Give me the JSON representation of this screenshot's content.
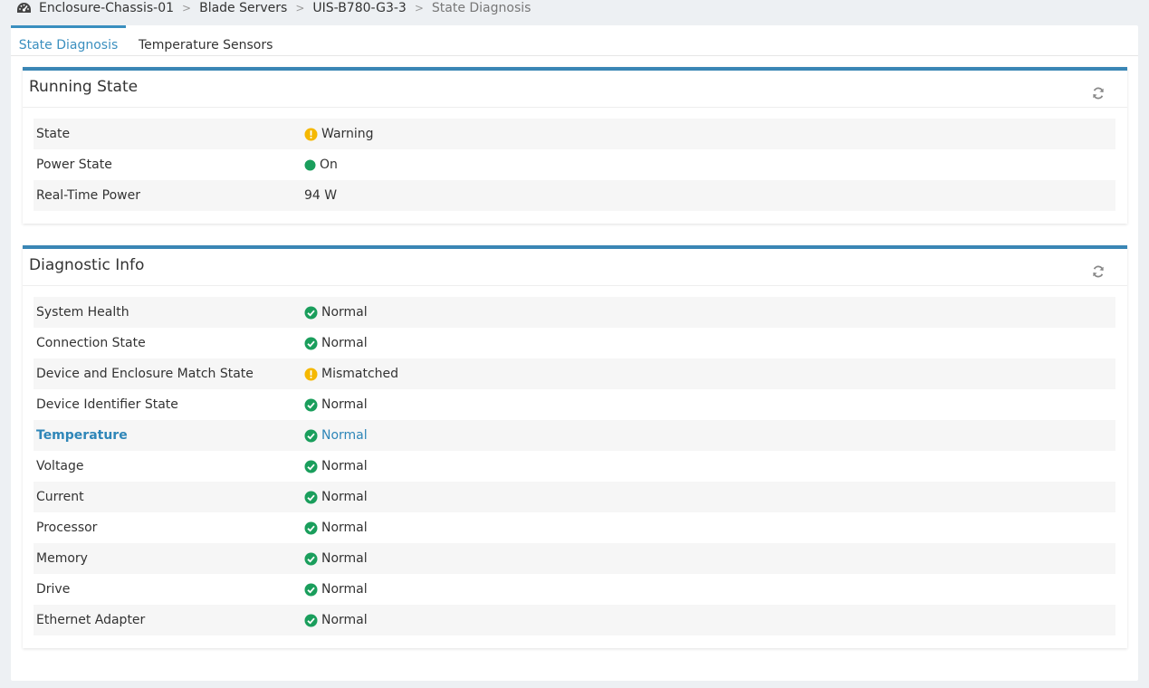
{
  "breadcrumb": {
    "items": [
      "Enclosure-Chassis-01",
      "Blade Servers",
      "UIS-B780-G3-3",
      "State Diagnosis"
    ],
    "separator": ">"
  },
  "tabs": [
    {
      "label": "State Diagnosis",
      "active": true
    },
    {
      "label": "Temperature Sensors",
      "active": false
    }
  ],
  "running_state": {
    "title": "Running State",
    "rows": [
      {
        "label": "State",
        "value": "Warning",
        "icon": "warning-icon"
      },
      {
        "label": "Power State",
        "value": "On",
        "icon": "dot-icon"
      },
      {
        "label": "Real-Time Power",
        "value": "94 W",
        "icon": ""
      }
    ]
  },
  "diagnostic_info": {
    "title": "Diagnostic Info",
    "rows": [
      {
        "label": "System Health",
        "value": "Normal",
        "icon": "check-icon"
      },
      {
        "label": "Connection State",
        "value": "Normal",
        "icon": "check-icon"
      },
      {
        "label": "Device and Enclosure Match State",
        "value": "Mismatched",
        "icon": "warning-icon"
      },
      {
        "label": "Device Identifier State",
        "value": "Normal",
        "icon": "check-icon"
      },
      {
        "label": "Temperature",
        "value": "Normal",
        "icon": "check-icon",
        "link": true
      },
      {
        "label": "Voltage",
        "value": "Normal",
        "icon": "check-icon"
      },
      {
        "label": "Current",
        "value": "Normal",
        "icon": "check-icon"
      },
      {
        "label": "Processor",
        "value": "Normal",
        "icon": "check-icon"
      },
      {
        "label": "Memory",
        "value": "Normal",
        "icon": "check-icon"
      },
      {
        "label": "Drive",
        "value": "Normal",
        "icon": "check-icon"
      },
      {
        "label": "Ethernet Adapter",
        "value": "Normal",
        "icon": "check-icon"
      }
    ]
  },
  "colors": {
    "accent": "#3a8fbf",
    "ok": "#1a9e5c",
    "warning": "#f5b800"
  }
}
